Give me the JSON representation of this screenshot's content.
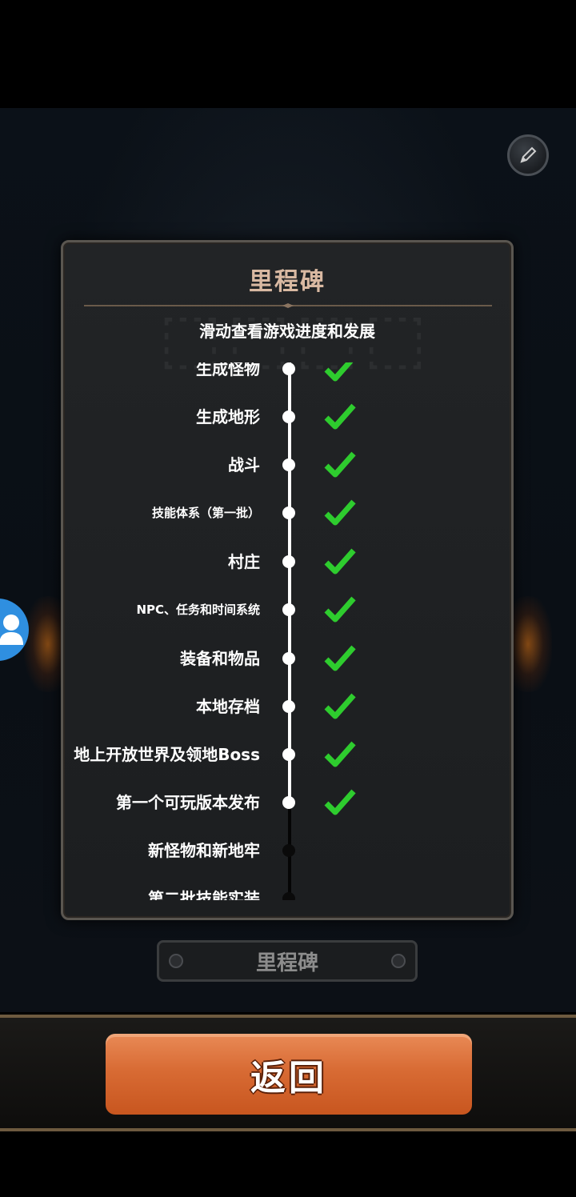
{
  "panel": {
    "title": "里程碑",
    "subtitle": "滑动查看游戏进度和发展"
  },
  "milestones": [
    {
      "label": "生成怪物",
      "done": true
    },
    {
      "label": "生成地形",
      "done": true
    },
    {
      "label": "战斗",
      "done": true
    },
    {
      "label": "技能体系（第一批）",
      "done": true
    },
    {
      "label": "村庄",
      "done": true
    },
    {
      "label": "NPC、任务和时间系统",
      "done": true
    },
    {
      "label": "装备和物品",
      "done": true
    },
    {
      "label": "本地存档",
      "done": true
    },
    {
      "label": "地上开放世界及领地Boss",
      "done": true
    },
    {
      "label": "第一个可玩版本发布",
      "done": true
    },
    {
      "label": "新怪物和新地牢",
      "done": false
    },
    {
      "label": "第二批技能实装",
      "done": false
    }
  ],
  "buttons": {
    "milestone_label": "里程碑",
    "back_label": "返回"
  },
  "icons": {
    "edit": "pencil-icon",
    "user": "user-icon",
    "done": "checkmark-icon"
  },
  "colors": {
    "check": "#2ecc2e",
    "back_button": "#d86b34",
    "title": "#d9b9a2"
  }
}
